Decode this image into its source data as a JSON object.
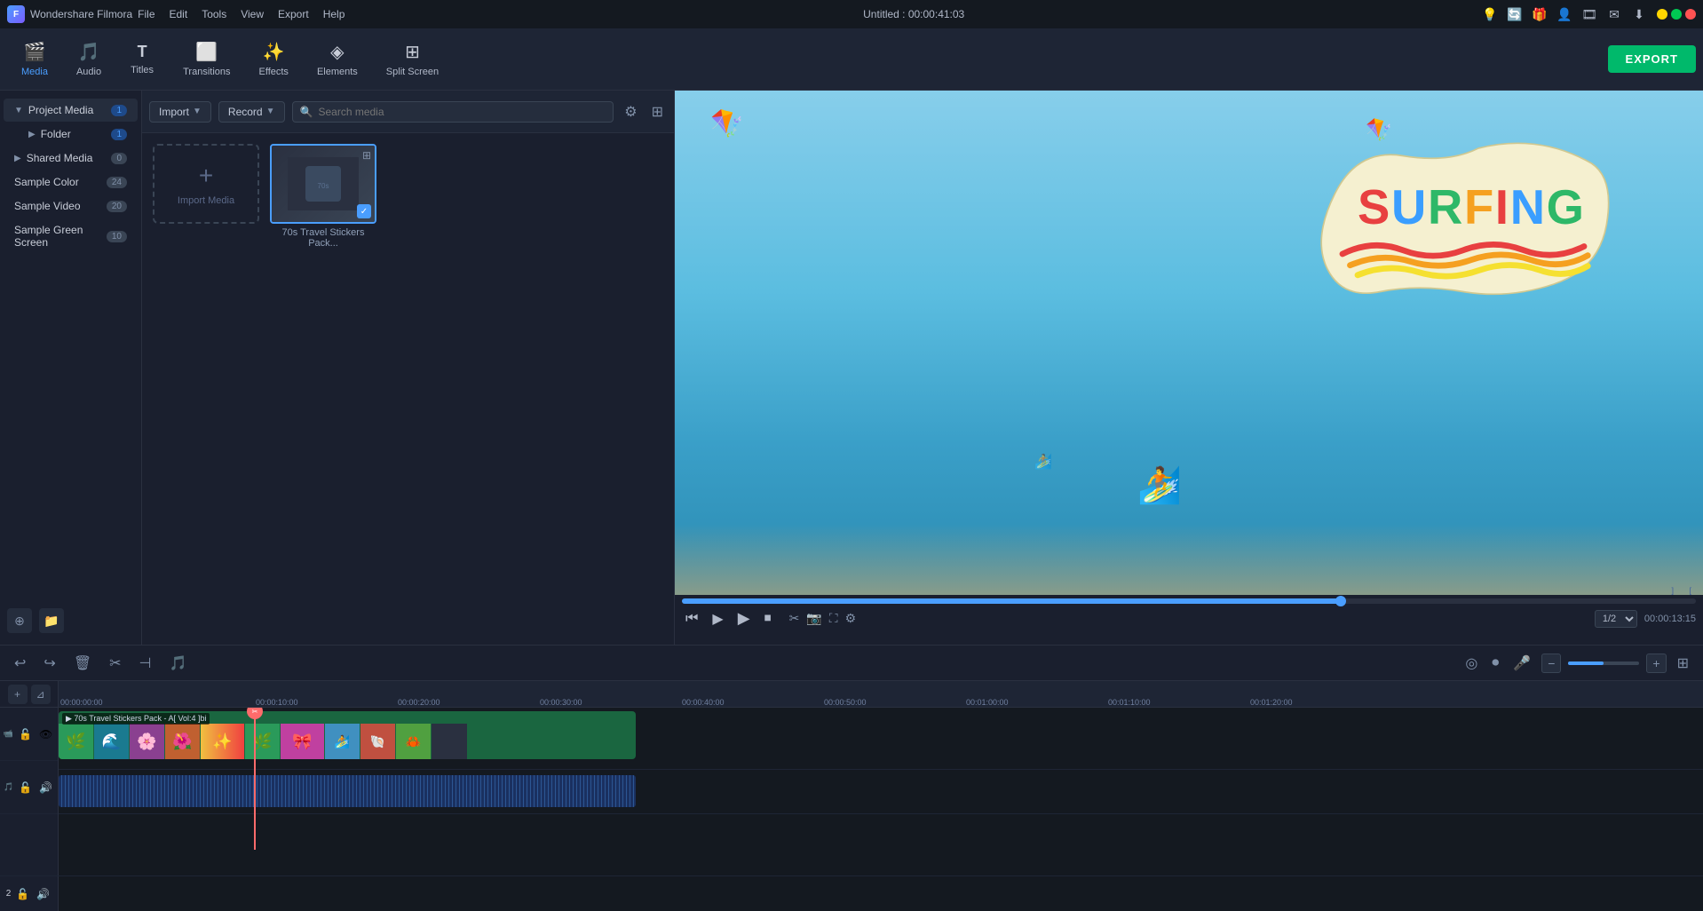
{
  "app": {
    "name": "Wondershare Filmora",
    "title": "Untitled : 00:00:41:03",
    "logo": "F"
  },
  "menu": {
    "items": [
      "File",
      "Edit",
      "Tools",
      "View",
      "Export",
      "Help"
    ]
  },
  "window_controls": {
    "minimize": "−",
    "maximize": "□",
    "close": "×"
  },
  "toolbar": {
    "items": [
      {
        "id": "media",
        "label": "Media",
        "icon": "🎬",
        "active": true
      },
      {
        "id": "audio",
        "label": "Audio",
        "icon": "🎵",
        "active": false
      },
      {
        "id": "titles",
        "label": "Titles",
        "icon": "T",
        "active": false
      },
      {
        "id": "transitions",
        "label": "Transitions",
        "icon": "⬜",
        "active": false
      },
      {
        "id": "effects",
        "label": "Effects",
        "icon": "✨",
        "active": false
      },
      {
        "id": "elements",
        "label": "Elements",
        "icon": "◈",
        "active": false
      },
      {
        "id": "split_screen",
        "label": "Split Screen",
        "icon": "⊞",
        "active": false
      }
    ],
    "export_label": "EXPORT"
  },
  "sidebar": {
    "items": [
      {
        "id": "project_media",
        "label": "Project Media",
        "count": "1",
        "expanded": true
      },
      {
        "id": "folder",
        "label": "Folder",
        "count": "1",
        "indent": true
      },
      {
        "id": "shared_media",
        "label": "Shared Media",
        "count": "0"
      },
      {
        "id": "sample_color",
        "label": "Sample Color",
        "count": "24"
      },
      {
        "id": "sample_video",
        "label": "Sample Video",
        "count": "20"
      },
      {
        "id": "sample_green",
        "label": "Sample Green Screen",
        "count": "10"
      }
    ]
  },
  "media_toolbar": {
    "import_label": "Import",
    "record_label": "Record",
    "search_placeholder": "Search media"
  },
  "media_items": [
    {
      "id": "import",
      "label": "Import Media",
      "type": "import"
    },
    {
      "id": "sticker_pack",
      "label": "70s Travel Stickers Pack...",
      "type": "media"
    }
  ],
  "preview": {
    "time_current": "00:00:13:15",
    "resolution": "1/2",
    "progress_pct": 65
  },
  "timeline": {
    "markers": [
      "00:00:00:00",
      "00:00:10:00",
      "00:00:20:00",
      "00:00:30:00",
      "00:00:40:00",
      "00:00:50:00",
      "00:01:00:00",
      "00:01:10:00",
      "00:01:20:00"
    ],
    "track_label": "70s Travel Stickers Pack - A[ Vol:4 ]bi",
    "playhead_pos": "00:00:10:00"
  },
  "player_controls": {
    "skip_back": "⏮",
    "play": "▶",
    "play_pause": "⏸",
    "stop": "⏹",
    "skip_fwd": "⏭"
  },
  "title_bar_icons": [
    "💡",
    "🔄",
    "🎁",
    "👤",
    "🎞",
    "✉",
    "⬇"
  ]
}
